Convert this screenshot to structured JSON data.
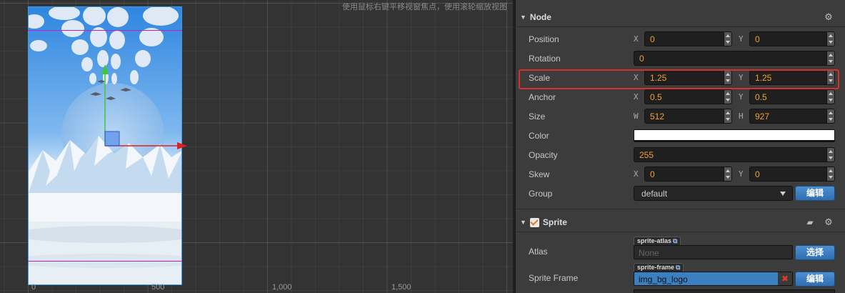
{
  "scene": {
    "hint": "使用鼠标右键平移视窗焦点，使用滚轮缩放视图",
    "ruler_labels": [
      "0",
      "500",
      "1,000",
      "1,500"
    ]
  },
  "inspector": {
    "node_section": {
      "title": "Node",
      "position": {
        "label": "Position",
        "x_axis": "X",
        "x": "0",
        "y_axis": "Y",
        "y": "0"
      },
      "rotation": {
        "label": "Rotation",
        "value": "0"
      },
      "scale": {
        "label": "Scale",
        "x_axis": "X",
        "x": "1.25",
        "y_axis": "Y",
        "y": "1.25"
      },
      "anchor": {
        "label": "Anchor",
        "x_axis": "X",
        "x": "0.5",
        "y_axis": "Y",
        "y": "0.5"
      },
      "size": {
        "label": "Size",
        "w_axis": "W",
        "w": "512",
        "h_axis": "H",
        "h": "927"
      },
      "color": {
        "label": "Color",
        "value_hex": "#ffffff"
      },
      "opacity": {
        "label": "Opacity",
        "value": "255"
      },
      "skew": {
        "label": "Skew",
        "x_axis": "X",
        "x": "0",
        "y_axis": "Y",
        "y": "0"
      },
      "group": {
        "label": "Group",
        "value": "default",
        "edit_label": "编辑"
      }
    },
    "sprite_section": {
      "title": "Sprite",
      "enabled": true,
      "atlas": {
        "label": "Atlas",
        "tag": "sprite-atlas",
        "value": "None",
        "choose_label": "选择"
      },
      "sprite_frame": {
        "label": "Sprite Frame",
        "tag": "sprite-frame",
        "value": "img_bg_logo",
        "clear_label": "✖",
        "edit_label": "编辑"
      }
    }
  },
  "colors": {
    "value_orange": "#f0a030",
    "highlight_red": "#d9302a",
    "selection_blue": "#3c9ee6",
    "guide_magenta": "#c21cc2"
  }
}
